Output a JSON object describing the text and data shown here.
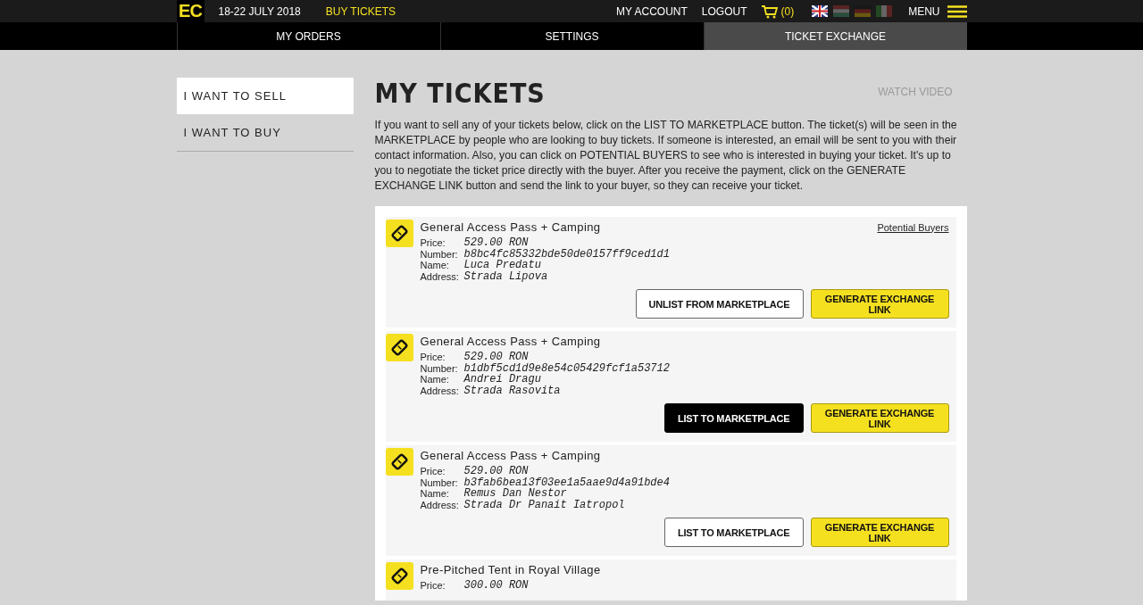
{
  "header": {
    "logo": "EC",
    "dates": "18-22 JULY 2018",
    "buy_link": "BUY TICKETS",
    "account": "MY ACCOUNT",
    "logout": "LOGOUT",
    "cart_count": "(0)",
    "languages": [
      {
        "kind": "uk",
        "selected": true
      },
      {
        "kind": "hu",
        "selected": false
      },
      {
        "kind": "de",
        "selected": false
      },
      {
        "kind": "it",
        "selected": false
      }
    ],
    "menu": "MENU"
  },
  "tabs": [
    {
      "label": "MY ORDERS",
      "selected": false
    },
    {
      "label": "SETTINGS",
      "selected": false
    },
    {
      "label": "TICKET EXCHANGE",
      "selected": true
    }
  ],
  "sidebar": {
    "items": [
      {
        "label": "I WANT TO SELL",
        "selected": true
      },
      {
        "label": "I WANT TO BUY",
        "selected": false
      }
    ]
  },
  "page": {
    "title": "MY TICKETS",
    "watch_video": "WATCH VIDEO",
    "intro": "If you want to sell any of your tickets below, click on the LIST TO MARKETPLACE button. The ticket(s) will be seen in the MARKETPLACE by people who are looking to buy tickets. If someone is interested, an email will be sent to you with their contact information. Also, you can click on POTENTIAL BUYERS to see who is interested in buying your ticket. It's up to you to negotiate the ticket price directly with the buyer. After you receive the payment, click on the GENERATE EXCHANGE LINK button and send the link to your buyer, so they can receive your ticket."
  },
  "tickets": [
    {
      "title": "General Access Pass + Camping",
      "potential_buyers": "Potential Buyers",
      "fields": [
        {
          "label": "Price:",
          "value": "529.00 RON"
        },
        {
          "label": "Number:",
          "value": "b8bc4fc85332bde50de0157ff9ced1d1"
        },
        {
          "label": "Name:",
          "value": "Luca Predatu"
        },
        {
          "label": "Address:",
          "value": "Strada Lipova"
        }
      ],
      "market_button": {
        "label": "UNLIST FROM MARKETPLACE",
        "hovered": false
      },
      "exchange_button": "GENERATE EXCHANGE LINK"
    },
    {
      "title": "General Access Pass + Camping",
      "fields": [
        {
          "label": "Price:",
          "value": "529.00 RON"
        },
        {
          "label": "Number:",
          "value": "b1dbf5cd1d9e8e54c05429fcf1a53712"
        },
        {
          "label": "Name:",
          "value": "Andrei Dragu"
        },
        {
          "label": "Address:",
          "value": "Strada Rasovita"
        }
      ],
      "market_button": {
        "label": "LIST TO MARKETPLACE",
        "hovered": true
      },
      "exchange_button": "GENERATE EXCHANGE LINK"
    },
    {
      "title": "General Access Pass + Camping",
      "fields": [
        {
          "label": "Price:",
          "value": "529.00 RON"
        },
        {
          "label": "Number:",
          "value": "b3fab6bea13f03ee1a5aae9d4a91bde4"
        },
        {
          "label": "Name:",
          "value": "Remus Dan Nestor"
        },
        {
          "label": "Address:",
          "value": "Strada Dr Panait Iatropol"
        }
      ],
      "market_button": {
        "label": "LIST TO MARKETPLACE",
        "hovered": false
      },
      "exchange_button": "GENERATE EXCHANGE LINK"
    },
    {
      "title": "Pre-Pitched Tent in Royal Village",
      "fields": [
        {
          "label": "Price:",
          "value": "300.00 RON"
        }
      ]
    }
  ]
}
